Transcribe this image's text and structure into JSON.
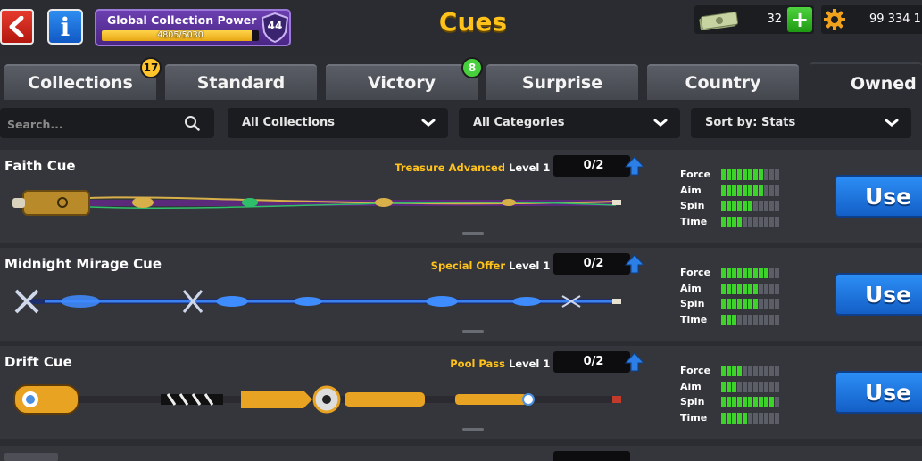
{
  "header": {
    "title": "Cues",
    "back_icon": "back-arrow-icon",
    "info_icon": "info-icon",
    "collection_power": {
      "label": "Global Collection Power",
      "value": "4805/5030",
      "progress": 0.955,
      "level": "44"
    },
    "cash": {
      "amount": "32",
      "icon": "cash-icon",
      "add_icon": "plus-icon"
    },
    "coins": {
      "amount": "99 334 1",
      "icon": "coin-icon"
    }
  },
  "tabs": [
    {
      "label": "Collections",
      "badge": "17",
      "badge_color": "#ffc52b"
    },
    {
      "label": "Standard"
    },
    {
      "label": "Victory",
      "badge": "8",
      "badge_color": "#46d03b"
    },
    {
      "label": "Surprise"
    },
    {
      "label": "Country"
    },
    {
      "label": "Owned",
      "active": true
    }
  ],
  "filters": {
    "search_placeholder": "Search...",
    "collections": "All Collections",
    "categories": "All Categories",
    "sort": "Sort by: Stats"
  },
  "stat_labels": [
    "Force",
    "Aim",
    "Spin",
    "Time"
  ],
  "stat_max": 11,
  "cues": [
    {
      "name": "Faith Cue",
      "source": "Treasure Advanced",
      "level": "Level 1",
      "progress": "0/2",
      "stats": [
        8,
        8,
        6,
        4
      ],
      "use_label": "Use",
      "colors": [
        "#b98a2a",
        "#5b2a7a",
        "#d8b04a"
      ]
    },
    {
      "name": "Midnight Mirage Cue",
      "source": "Special Offer",
      "level": "Level 1",
      "progress": "0/2",
      "stats": [
        9,
        7,
        7,
        3
      ],
      "use_label": "Use",
      "colors": [
        "#cfd8ea",
        "#1d2e6b",
        "#3f8cff"
      ]
    },
    {
      "name": "Drift Cue",
      "source": "Pool Pass",
      "level": "Level 1",
      "progress": "0/2",
      "stats": [
        4,
        3,
        10,
        5
      ],
      "use_label": "Use",
      "colors": [
        "#e8a322",
        "#2a2a30",
        "#4a8fe0"
      ]
    }
  ],
  "colors": {
    "accent_gold": "#ffc21a",
    "use_button": "#1f78e6",
    "stat_on": "#3cd429",
    "stat_off": "#5b5e66"
  }
}
